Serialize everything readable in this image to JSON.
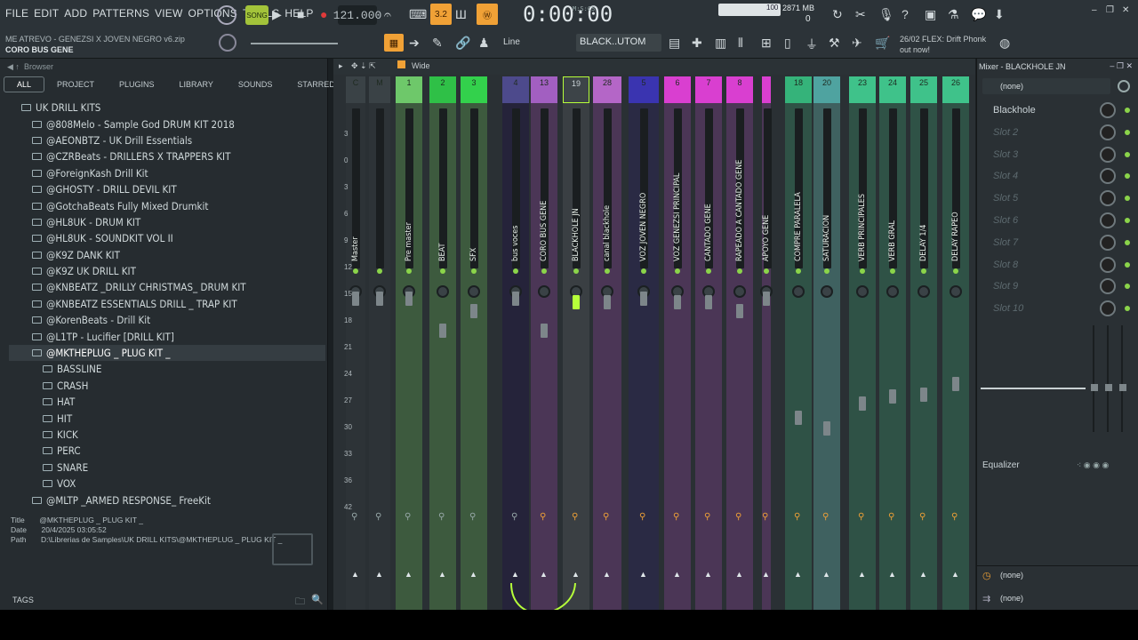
{
  "menu": [
    "FILE",
    "EDIT",
    "ADD",
    "PATTERNS",
    "VIEW",
    "OPTIONS",
    "TOOLS",
    "HELP"
  ],
  "transport": {
    "song_label": "SONG",
    "tempo": "121.000",
    "time": "0:00:00",
    "time_unit": "M:S:CS",
    "memory": "2871 MB",
    "cpu": "0",
    "volume_scale": "100"
  },
  "project": {
    "file": "ME ATREVO - GENEZSI X JOVEN NEGRO v6.zip",
    "selected": "CORO BUS GENE"
  },
  "toolbar2": {
    "snap": "Line",
    "pattern": "BLACK..UTOM"
  },
  "news": {
    "date": "26/02",
    "text": "FLEX: Drift Phonk",
    "text2": "out now!"
  },
  "browser": {
    "title": "Browser",
    "tabs": [
      "ALL",
      "PROJECT",
      "PLUGINS",
      "LIBRARY",
      "SOUNDS",
      "STARRED"
    ],
    "tree": [
      {
        "label": "UK DRILL KITS",
        "level": 0
      },
      {
        "label": "@808Melo - Sample God DRUM KIT 2018",
        "level": 1
      },
      {
        "label": "@AEONBTZ - UK Drill Essentials",
        "level": 1
      },
      {
        "label": "@CZRBeats - DRILLERS X TRAPPERS KIT",
        "level": 1
      },
      {
        "label": "@ForeignKash Drill Kit",
        "level": 1
      },
      {
        "label": "@GHOSTY - DRILL DEVIL KIT",
        "level": 1
      },
      {
        "label": "@GotchaBeats Fully Mixed Drumkit",
        "level": 1
      },
      {
        "label": "@HL8UK - DRUM KIT",
        "level": 1
      },
      {
        "label": "@HL8UK - SOUNDKIT VOL II",
        "level": 1
      },
      {
        "label": "@K9Z DANK KIT",
        "level": 1
      },
      {
        "label": "@K9Z UK DRILL KIT",
        "level": 1
      },
      {
        "label": "@KNBEATZ _DRILLY CHRISTMAS_ DRUM KIT",
        "level": 1
      },
      {
        "label": "@KNBEATZ ESSENTIALS DRILL _ TRAP KIT",
        "level": 1
      },
      {
        "label": "@KorenBeats - Drill Kit",
        "level": 1
      },
      {
        "label": "@L1TP - Lucifier [DRILL KIT]",
        "level": 1
      },
      {
        "label": "@MKTHEPLUG _ PLUG KIT _",
        "level": 1,
        "selected": true
      },
      {
        "label": "BASSLINE",
        "level": 2
      },
      {
        "label": "CRASH",
        "level": 2
      },
      {
        "label": "HAT",
        "level": 2
      },
      {
        "label": "HIT",
        "level": 2
      },
      {
        "label": "KICK",
        "level": 2
      },
      {
        "label": "PERC",
        "level": 2
      },
      {
        "label": "SNARE",
        "level": 2
      },
      {
        "label": "VOX",
        "level": 2
      },
      {
        "label": "@MLTP _ARMED RESPONSE_ FreeKit",
        "level": 1
      }
    ],
    "meta": {
      "title_label": "Title",
      "title": "@MKTHEPLUG _ PLUG KIT _",
      "date_label": "Date",
      "date": "20/4/2025 03:05:52",
      "path_label": "Path",
      "path": "D:\\Librerias de Samples\\UK DRILL KITS\\@MKTHEPLUG _ PLUG KIT _"
    },
    "tags_label": "TAGS"
  },
  "mixer": {
    "view": "Wide",
    "scale": [
      "3",
      "0",
      "3",
      "6",
      "9",
      "12",
      "15",
      "18",
      "21",
      "24",
      "27",
      "30",
      "33",
      "36",
      "42"
    ],
    "channels": [
      {
        "num": "C",
        "name": "Master",
        "color": "#3a4246"
      },
      {
        "num": "M",
        "name": "",
        "color": "#3a4246"
      },
      {
        "num": "1",
        "name": "Pre master",
        "color": "#6ec86a"
      },
      {
        "num": "2",
        "name": "BEAT",
        "color": "#2fc047"
      },
      {
        "num": "3",
        "name": "SFX",
        "color": "#33d14c"
      },
      {
        "num": "4",
        "name": "bus voces",
        "color": "#4d4a8c"
      },
      {
        "num": "13",
        "name": "CORO BUS GENE",
        "color": "#a25fc1"
      },
      {
        "num": "19",
        "name": "BLACKHOLE JN",
        "color": "#3d4448"
      },
      {
        "num": "28",
        "name": "canal blackhole",
        "color": "#b466c7"
      },
      {
        "num": "5",
        "name": "VOZ JOVEN NEGRO",
        "color": "#3a34b0"
      },
      {
        "num": "6",
        "name": "VOZ GENEZSI PRINCIPAL",
        "color": "#d93fd0"
      },
      {
        "num": "7",
        "name": "CANTADO GENE",
        "color": "#d93fd0"
      },
      {
        "num": "8",
        "name": "RAPEADO A CANTADO GENE",
        "color": "#d93fd0"
      },
      {
        "num": "",
        "name": "APOYO GENE",
        "color": "#d93fd0"
      },
      {
        "num": "18",
        "name": "COMPRE PARALELA",
        "color": "#35b37a"
      },
      {
        "num": "20",
        "name": "SATURACION",
        "color": "#4fa3a0"
      },
      {
        "num": "23",
        "name": "VERB PRINCIPALES",
        "color": "#3fc28a"
      },
      {
        "num": "24",
        "name": "VERB GRAL",
        "color": "#3fc28a"
      },
      {
        "num": "25",
        "name": "DELAY 1/4",
        "color": "#3fc28a"
      },
      {
        "num": "26",
        "name": "DELAY RAPEO",
        "color": "#3fc28a"
      }
    ]
  },
  "inspector": {
    "title": "Mixer - BLACKHOLE JN",
    "input": "(none)",
    "slots": [
      "Blackhole",
      "Slot 2",
      "Slot 3",
      "Slot 4",
      "Slot 5",
      "Slot 6",
      "Slot 7",
      "Slot 8",
      "Slot 9",
      "Slot 10"
    ],
    "eq_label": "Equalizer",
    "out1": "(none)",
    "out2": "(none)"
  }
}
